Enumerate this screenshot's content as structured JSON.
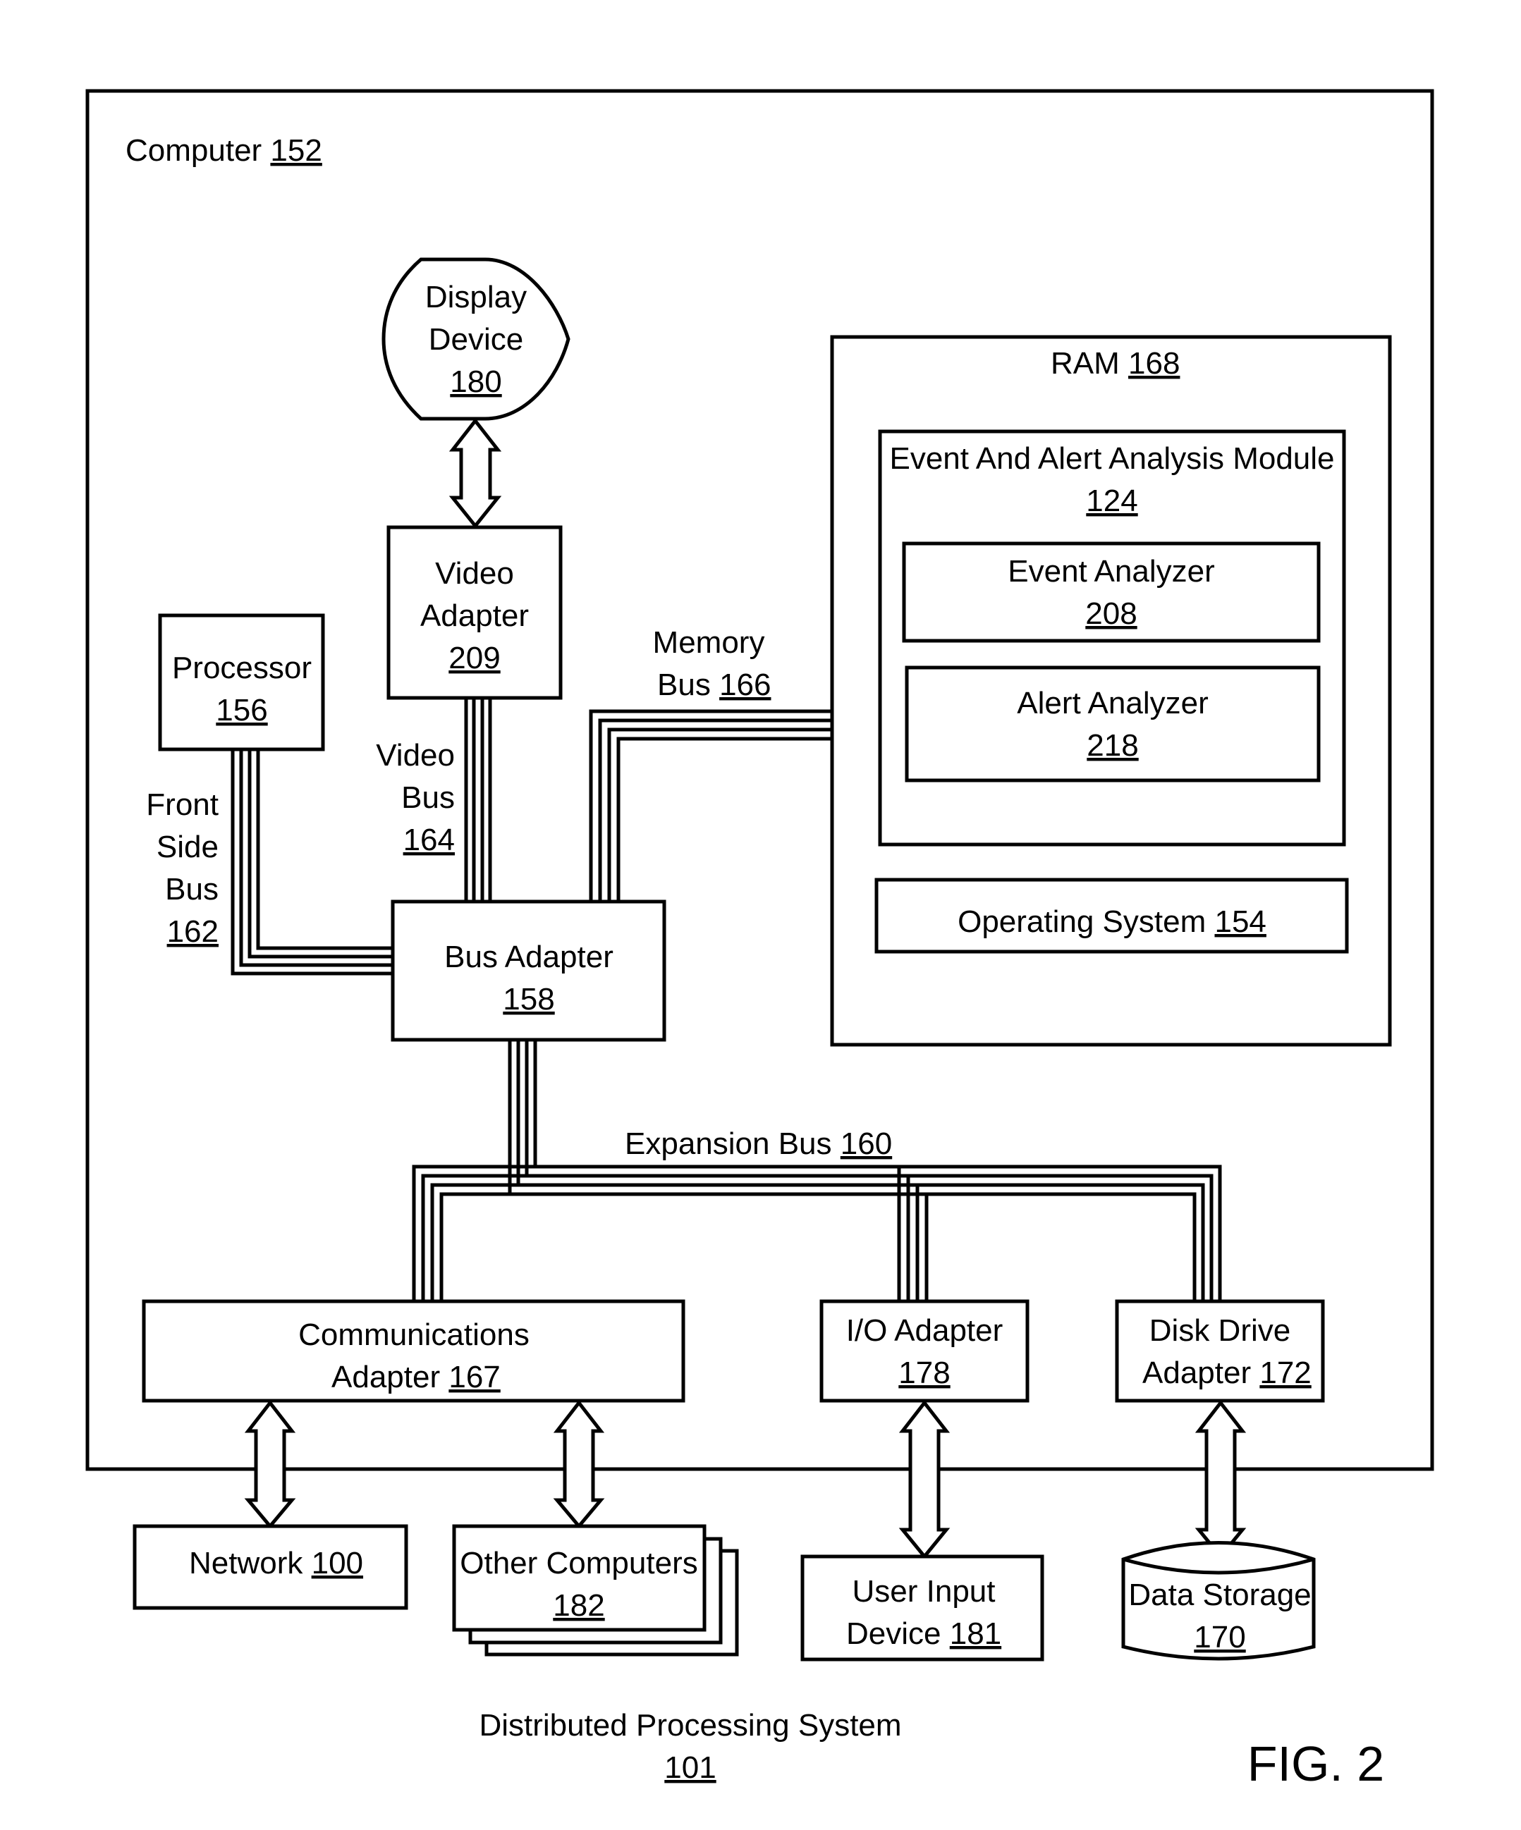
{
  "figure": {
    "label": "FIG. 2",
    "system_title": "Distributed Processing System",
    "system_ref": "101",
    "stroke_color": "#000000",
    "background_color": "#ffffff"
  },
  "computer": {
    "label": "Computer",
    "ref": "152"
  },
  "display_device": {
    "line1": "Display",
    "line2": "Device",
    "ref": "180"
  },
  "video_adapter": {
    "line1": "Video",
    "line2": "Adapter",
    "ref": "209"
  },
  "processor": {
    "line1": "Processor",
    "ref": "156"
  },
  "bus_adapter": {
    "line1": "Bus Adapter",
    "ref": "158"
  },
  "ram": {
    "label": "RAM",
    "ref": "168",
    "module": {
      "label": "Event And Alert Analysis Module",
      "ref": "124"
    },
    "event_analyzer": {
      "label": "Event Analyzer",
      "ref": "208"
    },
    "alert_analyzer": {
      "label": "Alert Analyzer",
      "ref": "218"
    },
    "operating_system": {
      "label": "Operating System",
      "ref": "154"
    }
  },
  "buses": {
    "memory_bus": {
      "line1": "Memory",
      "line2": "Bus",
      "ref": "166"
    },
    "video_bus": {
      "line1": "Video",
      "line2": "Bus",
      "ref": "164"
    },
    "front_side_bus": {
      "line1": "Front",
      "line2": "Side",
      "line3": "Bus",
      "ref": "162"
    },
    "expansion_bus": {
      "label": "Expansion Bus",
      "ref": "160"
    }
  },
  "communications_adapter": {
    "line1": "Communications",
    "line2": "Adapter",
    "ref": "167"
  },
  "io_adapter": {
    "line1": "I/O Adapter",
    "ref": "178"
  },
  "disk_drive_adapter": {
    "line1": "Disk Drive",
    "line2": "Adapter",
    "ref": "172"
  },
  "network": {
    "label": "Network",
    "ref": "100"
  },
  "other_computers": {
    "line1": "Other Computers",
    "ref": "182"
  },
  "user_input_device": {
    "line1": "User Input",
    "line2": "Device",
    "ref": "181"
  },
  "data_storage": {
    "line1": "Data Storage",
    "ref": "170"
  }
}
